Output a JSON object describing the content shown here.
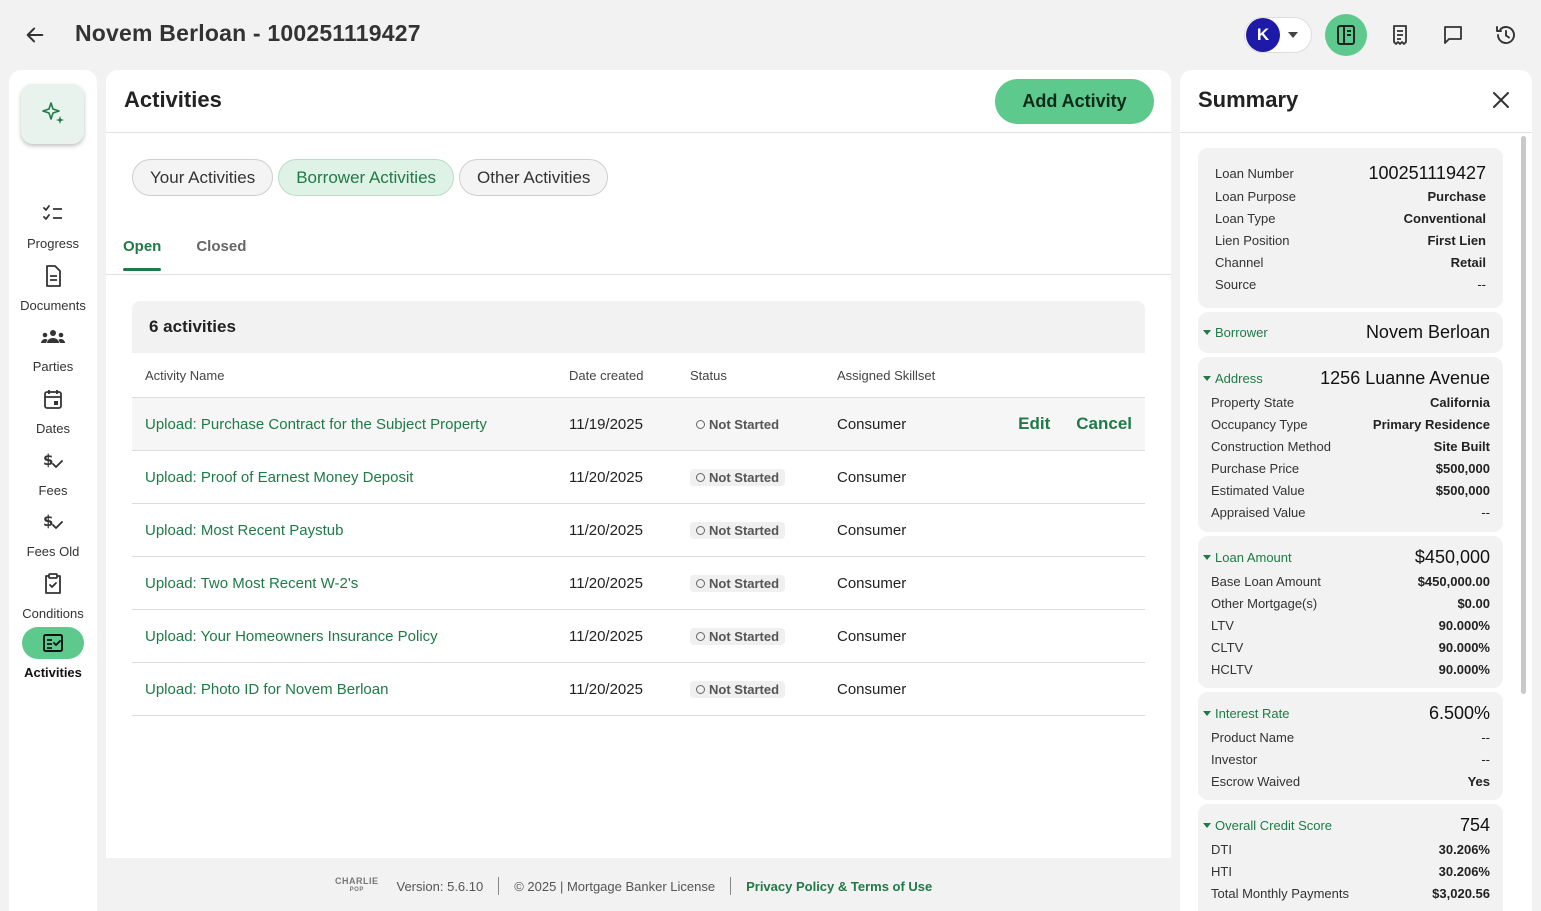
{
  "header": {
    "title": "Novem Berloan - 100251119427",
    "avatar_initial": "K"
  },
  "nav": {
    "items": [
      {
        "label": "Progress"
      },
      {
        "label": "Documents"
      },
      {
        "label": "Parties"
      },
      {
        "label": "Dates"
      },
      {
        "label": "Fees"
      },
      {
        "label": "Fees Old"
      },
      {
        "label": "Conditions"
      },
      {
        "label": "Activities"
      }
    ],
    "active": "Activities"
  },
  "activities": {
    "title": "Activities",
    "add_label": "Add Activity",
    "chips": [
      "Your Activities",
      "Borrower Activities",
      "Other Activities"
    ],
    "active_chip": "Borrower Activities",
    "subtabs": [
      "Open",
      "Closed"
    ],
    "active_subtab": "Open",
    "count_label": "6 activities",
    "columns": [
      "Activity Name",
      "Date created",
      "Status",
      "Assigned Skillset"
    ],
    "row_actions": {
      "edit": "Edit",
      "cancel": "Cancel"
    },
    "rows": [
      {
        "name": "Upload: Purchase Contract for the Subject Property",
        "date": "11/19/2025",
        "status": "Not Started",
        "skillset": "Consumer"
      },
      {
        "name": "Upload: Proof of Earnest Money Deposit",
        "date": "11/20/2025",
        "status": "Not Started",
        "skillset": "Consumer"
      },
      {
        "name": "Upload: Most Recent Paystub",
        "date": "11/20/2025",
        "status": "Not Started",
        "skillset": "Consumer"
      },
      {
        "name": "Upload: Two Most Recent W-2's",
        "date": "11/20/2025",
        "status": "Not Started",
        "skillset": "Consumer"
      },
      {
        "name": "Upload: Your Homeowners Insurance Policy",
        "date": "11/20/2025",
        "status": "Not Started",
        "skillset": "Consumer"
      },
      {
        "name": "Upload: Photo ID for Novem Berloan",
        "date": "11/20/2025",
        "status": "Not Started",
        "skillset": "Consumer"
      }
    ]
  },
  "footer": {
    "logo_top": "CHARLIE",
    "logo_bottom": "POP",
    "version": "Version: 5.6.10",
    "copyright": "© 2025 | Mortgage Banker License",
    "privacy": "Privacy Policy & Terms of Use"
  },
  "summary": {
    "title": "Summary",
    "loan": {
      "number_label": "Loan Number",
      "number": "100251119427",
      "rows": [
        {
          "k": "Loan Purpose",
          "v": "Purchase"
        },
        {
          "k": "Loan Type",
          "v": "Conventional"
        },
        {
          "k": "Lien Position",
          "v": "First Lien"
        },
        {
          "k": "Channel",
          "v": "Retail"
        },
        {
          "k": "Source",
          "v": "--"
        }
      ]
    },
    "borrower": {
      "label": "Borrower",
      "value": "Novem Berloan"
    },
    "address": {
      "label": "Address",
      "value": "1256 Luanne Avenue",
      "rows": [
        {
          "k": "Property State",
          "v": "California"
        },
        {
          "k": "Occupancy Type",
          "v": "Primary Residence"
        },
        {
          "k": "Construction Method",
          "v": "Site Built"
        },
        {
          "k": "Purchase Price",
          "v": "$500,000"
        },
        {
          "k": "Estimated Value",
          "v": "$500,000"
        },
        {
          "k": "Appraised Value",
          "v": "--"
        }
      ]
    },
    "loan_amount": {
      "label": "Loan Amount",
      "value": "$450,000",
      "rows": [
        {
          "k": "Base Loan Amount",
          "v": "$450,000.00"
        },
        {
          "k": "Other Mortgage(s)",
          "v": "$0.00"
        },
        {
          "k": "LTV",
          "v": "90.000%"
        },
        {
          "k": "CLTV",
          "v": "90.000%"
        },
        {
          "k": "HCLTV",
          "v": "90.000%"
        }
      ]
    },
    "interest_rate": {
      "label": "Interest Rate",
      "value": "6.500%",
      "rows": [
        {
          "k": "Product Name",
          "v": "--"
        },
        {
          "k": "Investor",
          "v": "--"
        },
        {
          "k": "Escrow Waived",
          "v": "Yes"
        }
      ]
    },
    "credit": {
      "label": "Overall Credit Score",
      "value": "754",
      "rows": [
        {
          "k": "DTI",
          "v": "30.206%"
        },
        {
          "k": "HTI",
          "v": "30.206%"
        },
        {
          "k": "Total Monthly Payments",
          "v": "$3,020.56"
        }
      ]
    }
  },
  "colors": {
    "accent": "#5ec98d",
    "link": "#1f7a47",
    "avatar": "#1d1aa8"
  }
}
